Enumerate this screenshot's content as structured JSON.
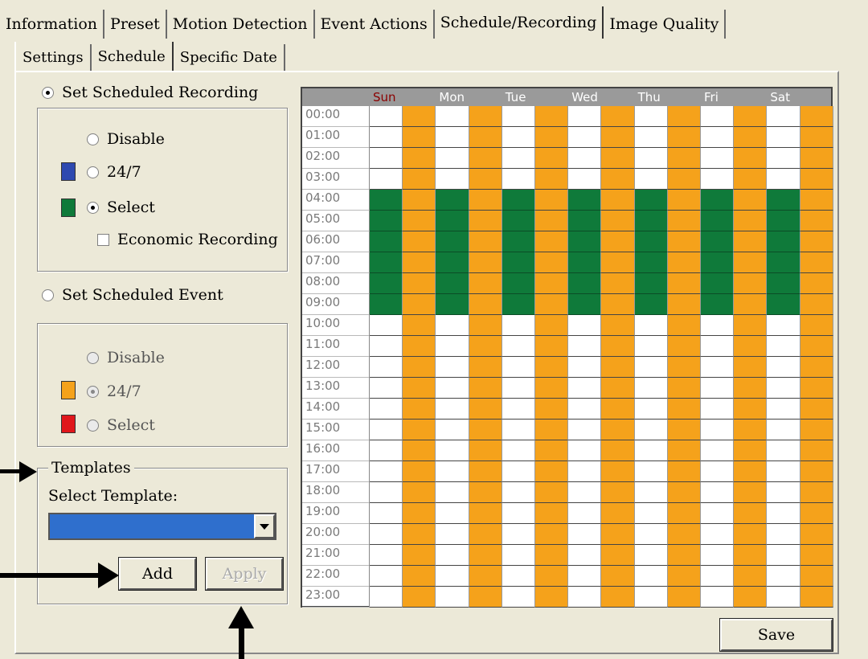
{
  "tabs": [
    "Information",
    "Preset",
    "Motion Detection",
    "Event Actions",
    "Schedule/Recording",
    "Image Quality"
  ],
  "subtabs": [
    "Settings",
    "Schedule",
    "Specific Date"
  ],
  "recording": {
    "label": "Set Scheduled Recording",
    "options": [
      "Disable",
      "24/7",
      "Select"
    ],
    "selected": "Select",
    "economic_label": "Economic Recording",
    "economic_checked": false,
    "colors": {
      "24/7": "#2e49b0",
      "Select": "#0f7a3a"
    }
  },
  "event": {
    "label": "Set Scheduled Event",
    "options": [
      "Disable",
      "24/7",
      "Select"
    ],
    "selected": "24/7",
    "colors": {
      "24/7": "#f5a21b",
      "Select": "#e0161b"
    }
  },
  "templates": {
    "legend": "Templates",
    "select_label": "Select Template:",
    "selected_value": "",
    "add_label": "Add",
    "apply_label": "Apply"
  },
  "save_label": "Save",
  "schedule": {
    "days": [
      "Sun",
      "Mon",
      "Tue",
      "Wed",
      "Thu",
      "Fri",
      "Sat"
    ],
    "hours": [
      "00:00",
      "01:00",
      "02:00",
      "03:00",
      "04:00",
      "05:00",
      "06:00",
      "07:00",
      "08:00",
      "09:00",
      "10:00",
      "11:00",
      "12:00",
      "13:00",
      "14:00",
      "15:00",
      "16:00",
      "17:00",
      "18:00",
      "19:00",
      "20:00",
      "21:00",
      "22:00",
      "23:00"
    ],
    "recording_hours": [
      "04:00",
      "05:00",
      "06:00",
      "07:00",
      "08:00",
      "09:00"
    ],
    "event_all_hours": true
  }
}
